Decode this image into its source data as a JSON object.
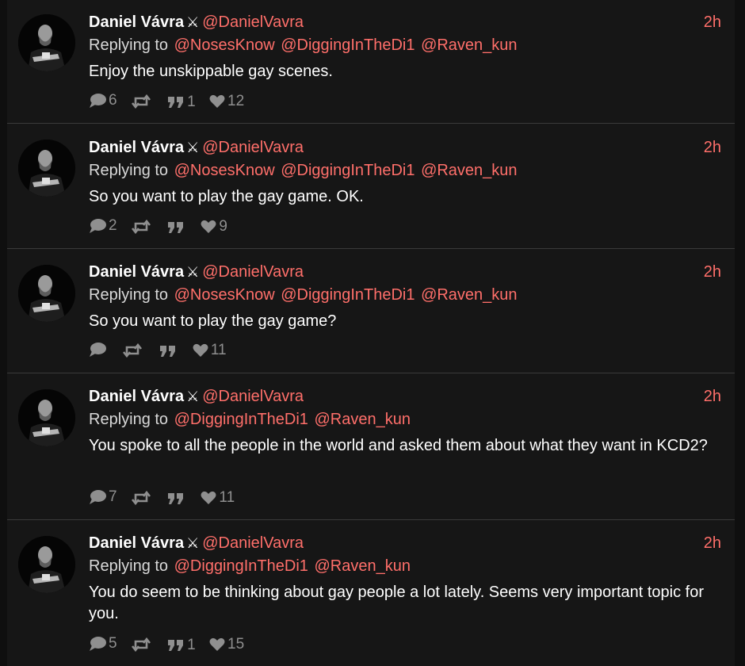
{
  "tweets": [
    {
      "display_name": "Daniel Vávra",
      "badge": "⚔",
      "handle": "@DanielVavra",
      "time": "2h",
      "replying_label": "Replying to",
      "mentions": [
        "@NosesKnow",
        "@DiggingInTheDi1",
        "@Raven_kun"
      ],
      "text": "Enjoy the unskippable gay scenes.",
      "replies": "6",
      "retweets": "",
      "quotes": "1",
      "likes": "12"
    },
    {
      "display_name": "Daniel Vávra",
      "badge": "⚔",
      "handle": "@DanielVavra",
      "time": "2h",
      "replying_label": "Replying to",
      "mentions": [
        "@NosesKnow",
        "@DiggingInTheDi1",
        "@Raven_kun"
      ],
      "text": "So you want to play the gay game. OK.",
      "replies": "2",
      "retweets": "",
      "quotes": "",
      "likes": "9"
    },
    {
      "display_name": "Daniel Vávra",
      "badge": "⚔",
      "handle": "@DanielVavra",
      "time": "2h",
      "replying_label": "Replying to",
      "mentions": [
        "@NosesKnow",
        "@DiggingInTheDi1",
        "@Raven_kun"
      ],
      "text": "So you want to play the gay game?",
      "replies": "",
      "retweets": "",
      "quotes": "",
      "likes": "11"
    },
    {
      "display_name": "Daniel Vávra",
      "badge": "⚔",
      "handle": "@DanielVavra",
      "time": "2h",
      "replying_label": "Replying to",
      "mentions": [
        "@DiggingInTheDi1",
        "@Raven_kun"
      ],
      "text": "You spoke to all the people in the world and asked them about what they want in KCD2?",
      "replies": "7",
      "retweets": "",
      "quotes": "",
      "likes": "11"
    },
    {
      "display_name": "Daniel Vávra",
      "badge": "⚔",
      "handle": "@DanielVavra",
      "time": "2h",
      "replying_label": "Replying to",
      "mentions": [
        "@DiggingInTheDi1",
        "@Raven_kun"
      ],
      "text": "You do seem to be thinking about gay people a lot lately.  Seems very important topic for you.",
      "replies": "5",
      "retweets": "",
      "quotes": "1",
      "likes": "15"
    }
  ],
  "icons": {
    "reply": "speech-bubble-icon",
    "retweet": "retweet-icon",
    "quote": "quote-icon",
    "like": "heart-icon"
  },
  "colors": {
    "background": "#161616",
    "accent": "#ff6f6a",
    "text": "#ffffff",
    "muted": "#8f8f8f",
    "separator": "#3a3a3a"
  }
}
